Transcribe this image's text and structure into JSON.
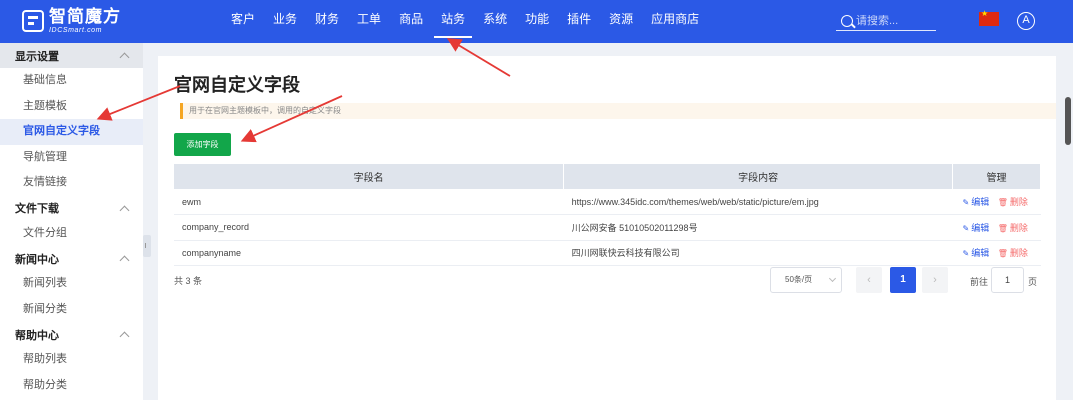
{
  "header": {
    "logo_title": "智简魔方",
    "logo_sub": "IDCSmart.com",
    "nav": [
      {
        "label": "客户"
      },
      {
        "label": "业务"
      },
      {
        "label": "财务"
      },
      {
        "label": "工单"
      },
      {
        "label": "商品"
      },
      {
        "label": "站务",
        "active": true
      },
      {
        "label": "系统"
      },
      {
        "label": "功能"
      },
      {
        "label": "插件"
      },
      {
        "label": "资源"
      },
      {
        "label": "应用商店"
      }
    ],
    "search_placeholder": "请搜索...",
    "flag_icon": "china-flag-icon",
    "avatar_letter": "A"
  },
  "sidebar": {
    "groups": [
      {
        "title": "显示设置",
        "items": [
          {
            "label": "基础信息"
          },
          {
            "label": "主题模板"
          },
          {
            "label": "官网自定义字段",
            "active": true
          },
          {
            "label": "导航管理"
          },
          {
            "label": "友情链接"
          }
        ]
      },
      {
        "title": "文件下载",
        "items": [
          {
            "label": "文件分组"
          }
        ]
      },
      {
        "title": "新闻中心",
        "items": [
          {
            "label": "新闻列表"
          },
          {
            "label": "新闻分类"
          }
        ]
      },
      {
        "title": "帮助中心",
        "items": [
          {
            "label": "帮助列表"
          },
          {
            "label": "帮助分类"
          }
        ]
      }
    ]
  },
  "main": {
    "title": "官网自定义字段",
    "hint": "用于在官网主题模板中，调用的自定义字段",
    "add_button": "添加字段",
    "table": {
      "headers": [
        "字段名",
        "字段内容",
        "管理"
      ],
      "rows": [
        {
          "name": "ewm",
          "content": "https://www.345idc.com/themes/web/web/static/picture/em.jpg"
        },
        {
          "name": "company_record",
          "content": "川公网安备 51010502011298号"
        },
        {
          "name": "companyname",
          "content": "四川网联快云科技有限公司"
        }
      ],
      "edit_label": "编辑",
      "delete_label": "删除"
    },
    "pagination": {
      "total": "共 3 条",
      "page_size": "50条/页",
      "prev": "‹",
      "current": "1",
      "next": "›",
      "goto_label": "前往",
      "goto_value": "1",
      "goto_unit": "页"
    }
  },
  "colors": {
    "brand": "#2b59e6",
    "success": "#12a64a",
    "danger": "#f56c6c",
    "annotation_arrow": "#e53935"
  }
}
